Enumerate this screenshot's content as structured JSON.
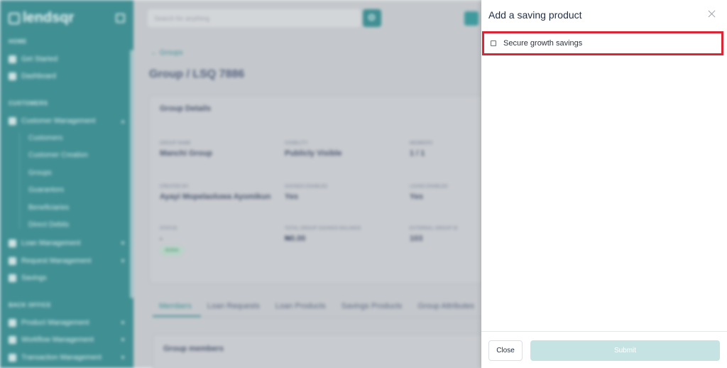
{
  "background": {
    "brand": "lendsqr",
    "search_placeholder": "Search for anything",
    "sidebar": {
      "sections": [
        {
          "label": "HOME",
          "items": [
            "Get Started",
            "Dashboard"
          ]
        },
        {
          "label": "CUSTOMERS",
          "items": [
            "Customer Management"
          ]
        },
        {
          "label": "BACK OFFICE",
          "items": [
            "Product Management",
            "Workflow Management",
            "Transaction Management"
          ]
        }
      ],
      "customer_sub": [
        "Customers",
        "Customer Creation",
        "Groups",
        "Guarantors",
        "Beneficiaries",
        "Direct Debits"
      ],
      "more_items": [
        "Loan Management",
        "Request Management",
        "Savings"
      ]
    },
    "back_label": "Groups",
    "page_title": "Group / LSQ 7886",
    "card_title": "Group Details",
    "fields": [
      {
        "label": "GROUP NAME",
        "value": "Manchi Group"
      },
      {
        "label": "VISIBILITY",
        "value": "Publicly Visible"
      },
      {
        "label": "MEMBERS",
        "value": "1 / 1"
      },
      {
        "label": "CREATED BY",
        "value": "Ayayi Mopelaoluwa Ayomikun"
      },
      {
        "label": "SAVINGS ENABLED",
        "value": "Yes"
      },
      {
        "label": "LOANS ENABLED",
        "value": "Yes"
      },
      {
        "label": "STATUS",
        "value": "-"
      },
      {
        "label": "TOTAL GROUP SAVINGS BALANCE",
        "value": "₦0.00"
      },
      {
        "label": "EXTERNAL GROUP ID",
        "value": "103"
      }
    ],
    "status_badge": "Active",
    "tabs": [
      "Members",
      "Loan Requests",
      "Loan Products",
      "Savings Products",
      "Group Attributes"
    ],
    "members_card_title": "Group members"
  },
  "modal": {
    "title": "Add a saving product",
    "options": [
      {
        "label": "Secure growth savings",
        "checked": false
      }
    ],
    "close_label": "Close",
    "submit_label": "Submit"
  },
  "colors": {
    "brand_teal": "#3f8f93",
    "highlight": "#dc2434",
    "submit_disabled": "#c6e3e3"
  }
}
